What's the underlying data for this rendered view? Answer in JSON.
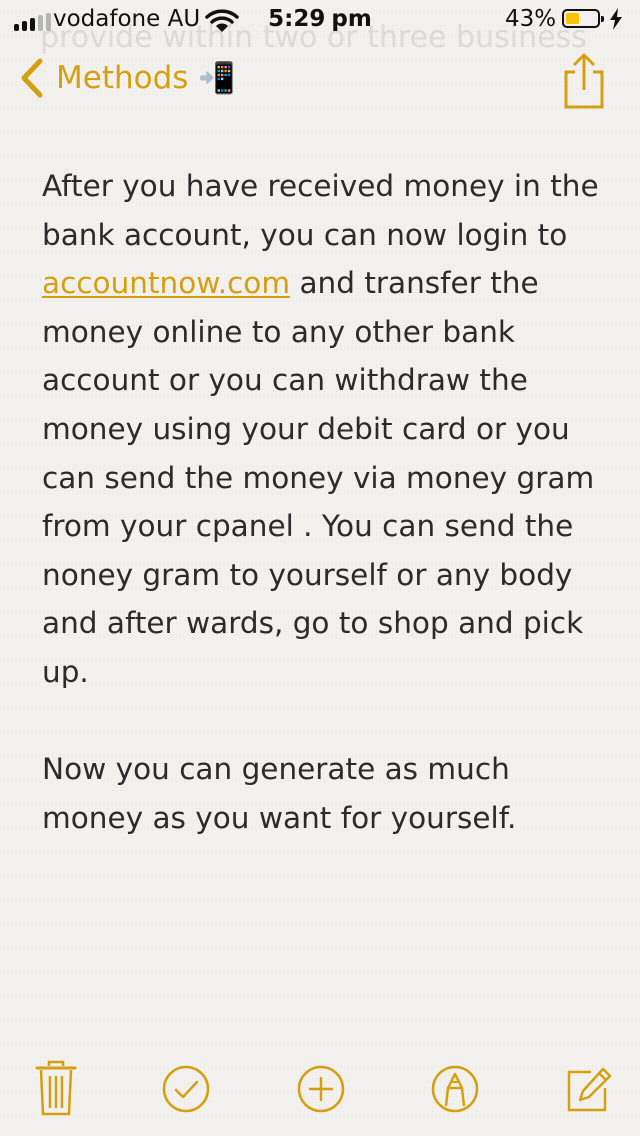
{
  "status_bar": {
    "carrier": "vodafone AU",
    "time": "5:29",
    "ampm": "pm",
    "battery_percent": "43%",
    "battery_level": 0.43,
    "signal_bars_filled": 3,
    "signal_bars_total": 5
  },
  "ghost_text": "provide within two or three business",
  "nav": {
    "back_label": "Methods",
    "title_emoji": "📲",
    "back_icon": "chevron-left-icon",
    "share_icon": "share-icon"
  },
  "note": {
    "p1_before": "After you have received money in the bank account, you can now login to ",
    "p1_link": "accountnow.com",
    "p1_after": " and transfer the money online to any other bank account or you can withdraw the money using your debit card or you can send the money via money gram from your cpanel . You can send the noney gram to yourself or any body and after wards, go to shop and pick up.",
    "p2": "Now you can generate as much money as you want for yourself."
  },
  "toolbar": {
    "icons": [
      "trash-icon",
      "checklist-icon",
      "add-icon",
      "markup-icon",
      "compose-icon"
    ]
  },
  "colors": {
    "accent": "#d4a012",
    "text": "#2b2b2b",
    "background": "#f3f2ef",
    "battery": "#f6c500"
  }
}
